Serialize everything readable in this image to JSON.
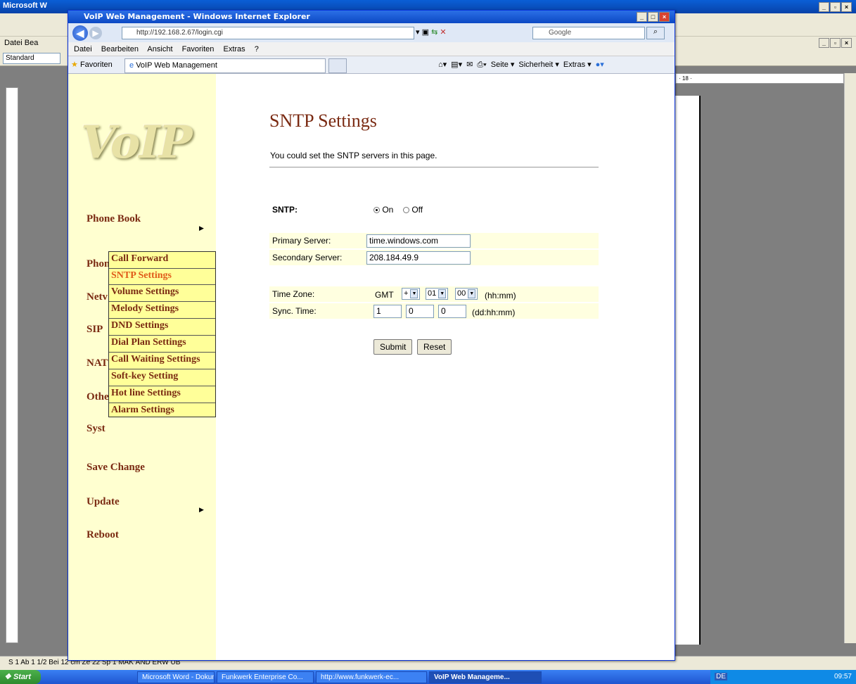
{
  "word": {
    "title": "Microsoft W",
    "menu_partial": "Datei  Bea",
    "style_box": "Standard",
    "ruler_mark": "· 18 ·",
    "status": "S 1      Ab 1        1/2      Bei 12 cm   Ze 22   Sp 1      MAK   ÄND   ERW   ÜB"
  },
  "ie": {
    "title": "VoIP Web Management - Windows Internet Explorer",
    "address": "http://192.168.2.67/login.cgi",
    "search_placeholder": "Google",
    "menu": [
      "Datei",
      "Bearbeiten",
      "Ansicht",
      "Favoriten",
      "Extras",
      "?"
    ],
    "favorites_label": "Favoriten",
    "tab_label": "VoIP Web Management",
    "command_items": [
      "Seite ▾",
      "Sicherheit ▾",
      "Extras ▾"
    ]
  },
  "sidebar": {
    "logo": "VoIP",
    "items": [
      {
        "label": "Phone Book"
      },
      {
        "label": "Phone Setting"
      },
      {
        "label": "Network"
      },
      {
        "label": "SIP"
      },
      {
        "label": "NAT"
      },
      {
        "label": "Others"
      },
      {
        "label": "System Auth"
      },
      {
        "label": "Save Change"
      },
      {
        "label": "Update"
      },
      {
        "label": "Reboot"
      }
    ],
    "partial_labels": [
      "Phon",
      "Netv",
      "SIP",
      "NAT",
      "Othe",
      "Syst"
    ],
    "submenu": [
      {
        "label": "Call Forward"
      },
      {
        "label": "SNTP Settings",
        "active": true
      },
      {
        "label": "Volume Settings"
      },
      {
        "label": "Melody Settings"
      },
      {
        "label": "DND Settings"
      },
      {
        "label": "Dial Plan Settings"
      },
      {
        "label": "Call Waiting Settings"
      },
      {
        "label": "Soft-key Setting"
      },
      {
        "label": "Hot line Settings"
      },
      {
        "label": "Alarm Settings"
      }
    ],
    "submenu_remnant": "Setting"
  },
  "main": {
    "title": "SNTP Settings",
    "description": "You could set the SNTP servers in this page.",
    "sntp_label": "SNTP:",
    "sntp_on": "On",
    "sntp_off": "Off",
    "primary_label": "Primary Server:",
    "primary_value": "time.windows.com",
    "secondary_label": "Secondary Server:",
    "secondary_value": "208.184.49.9",
    "timezone_label": "Time Zone:",
    "timezone_prefix": "GMT",
    "tz_sign": "+",
    "tz_hours": "01",
    "tz_minutes": "00",
    "tz_hint": "(hh:mm)",
    "sync_label": "Sync. Time:",
    "sync_dd": "1",
    "sync_hh": "0",
    "sync_mm": "0",
    "sync_hint": "(dd:hh:mm)",
    "submit": "Submit",
    "reset": "Reset"
  },
  "taskbar": {
    "start": "Start",
    "tasks": [
      {
        "label": "Microsoft Word - Dokum..."
      },
      {
        "label": "Funkwerk Enterprise Co..."
      },
      {
        "label": "http://www.funkwerk-ec..."
      },
      {
        "label": "VoIP Web Manageme..."
      }
    ],
    "clock": "09:57",
    "lang": "DE"
  }
}
